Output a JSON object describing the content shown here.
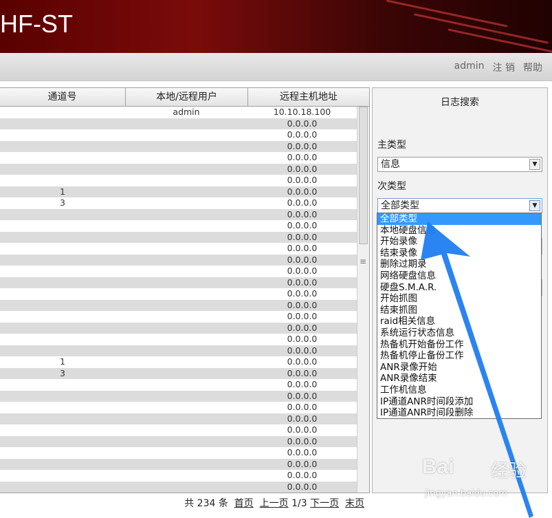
{
  "header": {
    "brand": "HF-ST"
  },
  "nav": {
    "user": "admin",
    "logout": "注 销",
    "help": "帮助"
  },
  "table": {
    "columns": [
      "通道号",
      "本地/远程用户",
      "远程主机地址"
    ],
    "rows": [
      {
        "channel": "",
        "user": "admin",
        "address": "10.10.18.100"
      },
      {
        "channel": "",
        "user": "",
        "address": "0.0.0.0"
      },
      {
        "channel": "",
        "user": "",
        "address": "0.0.0.0"
      },
      {
        "channel": "",
        "user": "",
        "address": "0.0.0.0"
      },
      {
        "channel": "",
        "user": "",
        "address": "0.0.0.0"
      },
      {
        "channel": "",
        "user": "",
        "address": "0.0.0.0"
      },
      {
        "channel": "",
        "user": "",
        "address": "0.0.0.0"
      },
      {
        "channel": "1",
        "user": "",
        "address": "0.0.0.0"
      },
      {
        "channel": "3",
        "user": "",
        "address": "0.0.0.0"
      },
      {
        "channel": "",
        "user": "",
        "address": "0.0.0.0"
      },
      {
        "channel": "",
        "user": "",
        "address": "0.0.0.0"
      },
      {
        "channel": "",
        "user": "",
        "address": "0.0.0.0"
      },
      {
        "channel": "",
        "user": "",
        "address": "0.0.0.0"
      },
      {
        "channel": "",
        "user": "",
        "address": "0.0.0.0"
      },
      {
        "channel": "",
        "user": "",
        "address": "0.0.0.0"
      },
      {
        "channel": "",
        "user": "",
        "address": "0.0.0.0"
      },
      {
        "channel": "",
        "user": "",
        "address": "0.0.0.0"
      },
      {
        "channel": "",
        "user": "",
        "address": "0.0.0.0"
      },
      {
        "channel": "",
        "user": "",
        "address": "0.0.0.0"
      },
      {
        "channel": "",
        "user": "",
        "address": "0.0.0.0"
      },
      {
        "channel": "",
        "user": "",
        "address": "0.0.0.0"
      },
      {
        "channel": "",
        "user": "",
        "address": "0.0.0.0"
      },
      {
        "channel": "1",
        "user": "",
        "address": "0.0.0.0"
      },
      {
        "channel": "3",
        "user": "",
        "address": "0.0.0.0"
      },
      {
        "channel": "",
        "user": "",
        "address": "0.0.0.0"
      },
      {
        "channel": "",
        "user": "",
        "address": "0.0.0.0"
      },
      {
        "channel": "",
        "user": "",
        "address": "0.0.0.0"
      },
      {
        "channel": "",
        "user": "",
        "address": "0.0.0.0"
      },
      {
        "channel": "",
        "user": "",
        "address": "0.0.0.0"
      },
      {
        "channel": "",
        "user": "",
        "address": "0.0.0.0"
      },
      {
        "channel": "",
        "user": "",
        "address": "0.0.0.0"
      },
      {
        "channel": "",
        "user": "",
        "address": "0.0.0.0"
      },
      {
        "channel": "",
        "user": "",
        "address": "0.0.0.0"
      },
      {
        "channel": "",
        "user": "",
        "address": "0.0.0.0"
      }
    ]
  },
  "pager": {
    "total": "共 234 条",
    "first": "首页",
    "prev": "上一页",
    "page": "1/3",
    "next": "下一页",
    "last": "末页"
  },
  "search": {
    "title": "日志搜索",
    "main_type_label": "主类型",
    "main_type_value": "信息",
    "sub_type_label": "次类型",
    "sub_type_value": "全部类型",
    "options": [
      "全部类型",
      "本地硬盘信息",
      "开始录像",
      "结束录像",
      "删除过期录",
      "网络硬盘信息",
      "硬盘S.M.A.R.",
      "开始抓图",
      "结束抓图",
      "raid相关信息",
      "系统运行状态信息",
      "热备机开始备份工作",
      "热备机停止备份工作",
      "ANR录像开始",
      "ANR录像结束",
      "工作机信息",
      "IP通道ANR时间段添加",
      "IP通道ANR时间段删除"
    ],
    "selected_index": 0
  },
  "watermark": {
    "brand": "Bai",
    "cn": "经验",
    "url": "jingyan.baidu.com"
  },
  "colors": {
    "banner": "#6b0808",
    "accent_arrow": "#1f7df0",
    "selection": "#3399ff",
    "zebra": "#dcdcdc"
  }
}
